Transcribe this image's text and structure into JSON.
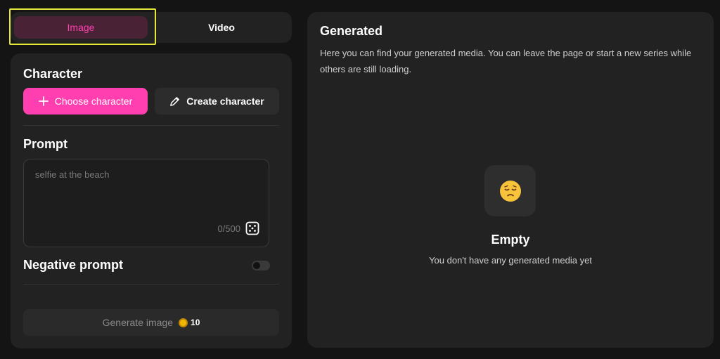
{
  "tabs": {
    "image_label": "Image",
    "video_label": "Video"
  },
  "character": {
    "title": "Character",
    "choose_label": "Choose character",
    "create_label": "Create character"
  },
  "prompt": {
    "title": "Prompt",
    "placeholder": "selfie at the beach",
    "char_count": "0/500"
  },
  "negative_prompt": {
    "title": "Negative prompt",
    "enabled": false
  },
  "generate": {
    "label": "Generate image",
    "cost": "10"
  },
  "generated": {
    "title": "Generated",
    "description": "Here you can find your generated media. You can leave the page or start a new series while others are still loading.",
    "empty_title": "Empty",
    "empty_subtitle": "You don't have any generated media yet"
  },
  "colors": {
    "accent": "#ff3fb0",
    "highlight": "#e5e83a",
    "panel": "#222222",
    "background": "#141414"
  }
}
